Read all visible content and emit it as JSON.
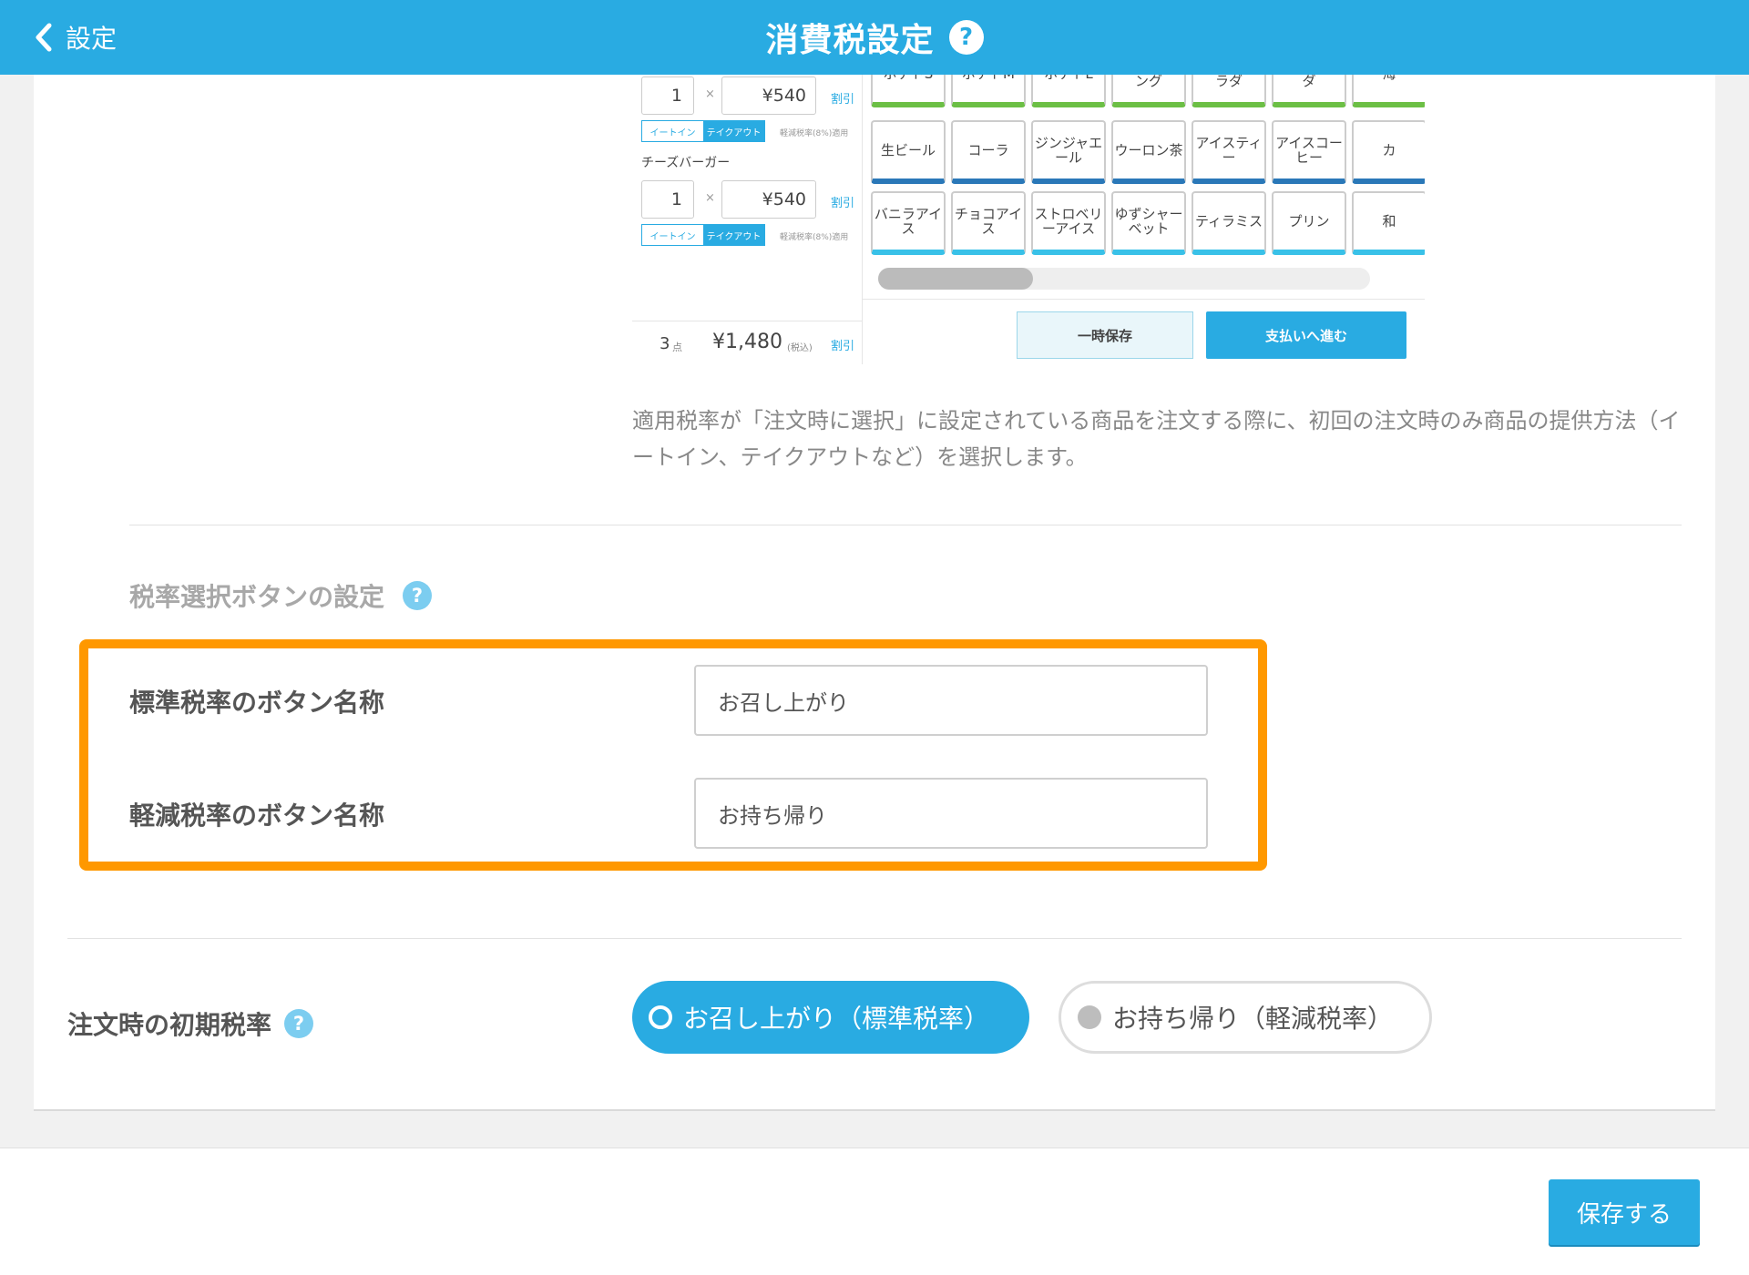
{
  "header": {
    "back_label": "設定",
    "title": "消費税設定",
    "help": "?"
  },
  "preview": {
    "items": [
      {
        "qty": "1",
        "times": "×",
        "price": "¥540",
        "discount": "割引",
        "eat_in": "イートイン",
        "take_out": "テイクアウト",
        "note": "軽減税率(8%)適用"
      },
      {
        "name": "チーズバーガー",
        "qty": "1",
        "times": "×",
        "price": "¥540",
        "discount": "割引",
        "eat_in": "イートイン",
        "take_out": "テイクアウト",
        "note": "軽減税率(8%)適用"
      }
    ],
    "total": {
      "count": "3",
      "count_unit": "点",
      "amount": "¥1,480",
      "tax_note": "(税込)",
      "discount": "割引"
    },
    "tiles_row1": [
      "ポテトS",
      "ポテトM",
      "ポテトL",
      "オニオンリ ング",
      "グリーンサ ラダ",
      "ポテトサラ ダ",
      "海"
    ],
    "tiles_row2": [
      "生ビール",
      "コーラ",
      "ジンジャエ ール",
      "ウーロン茶",
      "アイスティ ー",
      "アイスコー ヒー",
      "カ"
    ],
    "tiles_row3": [
      "バニラアイ ス",
      "チョコアイ ス",
      "ストロベリ ーアイス",
      "ゆずシャー ベット",
      "ティラミス",
      "プリン",
      "和"
    ],
    "temp_save": "一時保存",
    "proceed_pay": "支払いへ進む"
  },
  "description": "適用税率が「注文時に選択」に設定されている商品を注文する際に、初回の注文時のみ商品の提供方法（イートイン、テイクアウトなど）を選択します。",
  "tax_button_section": {
    "heading": "税率選択ボタンの設定",
    "standard_label": "標準税率のボタン名称",
    "standard_value": "お召し上がり",
    "reduced_label": "軽減税率のボタン名称",
    "reduced_value": "お持ち帰り"
  },
  "initial_rate": {
    "label": "注文時の初期税率",
    "option_standard": "お召し上がり（標準税率）",
    "option_reduced": "お持ち帰り（軽減税率）",
    "selected": "standard"
  },
  "footer": {
    "save_label": "保存する"
  },
  "colors": {
    "primary": "#29abe2",
    "highlight": "#ff9800"
  }
}
